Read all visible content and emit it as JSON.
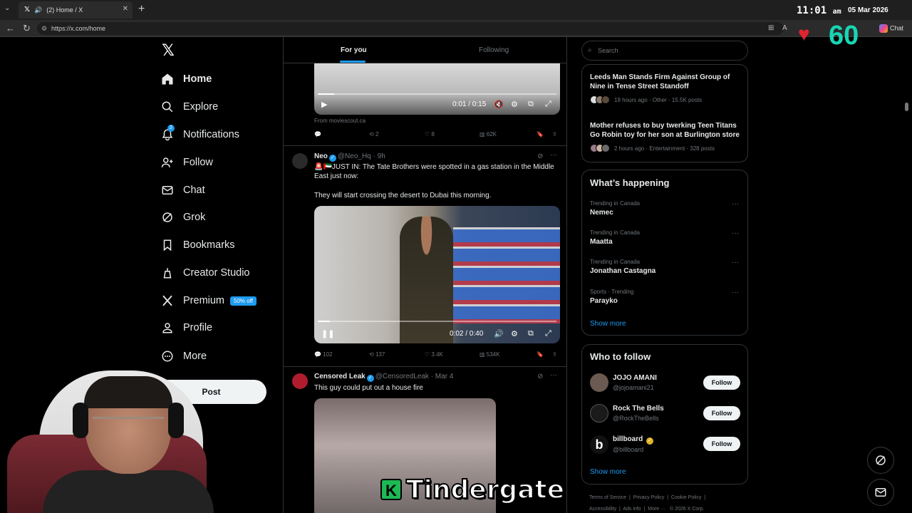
{
  "browser": {
    "tab_title": "(2) Home / X",
    "url": "https://x.com/home",
    "clock": "11:01",
    "clock_suffix": "am",
    "date": "05 Mar 2026",
    "chat_label": "Chat",
    "stream_counter": "60"
  },
  "nav": {
    "items": [
      {
        "label": "Home",
        "icon": "home-icon"
      },
      {
        "label": "Explore",
        "icon": "search-icon"
      },
      {
        "label": "Notifications",
        "icon": "bell-icon",
        "badge": "2"
      },
      {
        "label": "Follow",
        "icon": "add-user-icon"
      },
      {
        "label": "Chat",
        "icon": "mail-icon"
      },
      {
        "label": "Grok",
        "icon": "grok-icon"
      },
      {
        "label": "Bookmarks",
        "icon": "bookmark-icon"
      },
      {
        "label": "Creator Studio",
        "icon": "creator-icon"
      },
      {
        "label": "Premium",
        "icon": "x-icon",
        "badge": "50% off"
      },
      {
        "label": "Profile",
        "icon": "person-icon"
      },
      {
        "label": "More",
        "icon": "more-circle-icon"
      }
    ],
    "post_label": "Post"
  },
  "timeline": {
    "tabs": [
      "For you",
      "Following"
    ],
    "post1": {
      "video_time": "0:01 / 0:15",
      "video_progress": 0.07,
      "source": "From moviescout.ca",
      "reposts": "2",
      "likes": "8",
      "views": "62K"
    },
    "post2": {
      "name": "Neo",
      "handle": "@Neo_Hq",
      "age": "· 9h",
      "text1": "🚨🇦🇪JUST IN: The Tate Brothers were spotted in a gas station in the Middle East just now:",
      "text2": "They will start crossing the desert to Dubai this morning.",
      "video_time": "0:02 / 0:40",
      "video_progress": 0.05,
      "replies": "102",
      "reposts": "137",
      "likes": "3.4K",
      "views": "534K"
    },
    "post3": {
      "name": "Censored Leak",
      "handle": "@CensoredLeak",
      "age": "· Mar 4",
      "text": "This guy could put out a house fire"
    }
  },
  "right": {
    "search_placeholder": "Search",
    "news": [
      {
        "title": "Leeds Man Stands Firm Against Group of Nine in Tense Street Standoff",
        "meta": "19 hours ago · Other · 15.5K posts"
      },
      {
        "title": "Mother refuses to buy twerking Teen Titans Go Robin toy for her son at Burlington store",
        "meta": "2 hours ago · Entertainment · 328 posts"
      }
    ],
    "happening_title": "What’s happening",
    "trends": [
      {
        "meta": "Trending in Canada",
        "name": "Nemec"
      },
      {
        "meta": "Trending in Canada",
        "name": "Maatta"
      },
      {
        "meta": "Trending in Canada",
        "name": "Jonathan Castagna"
      },
      {
        "meta": "Sports · Trending",
        "name": "Parayko"
      }
    ],
    "show_more": "Show more",
    "wtf_title": "Who to follow",
    "wtf": [
      {
        "name": "JOJO AMANI",
        "handle": "@jojoamani21",
        "button": "Follow",
        "color": "#6b5a52"
      },
      {
        "name": "Rock The Bells",
        "handle": "@RockTheBells",
        "button": "Follow",
        "color": "#1a1a1a"
      },
      {
        "name": "billboard",
        "handle": "@billboard",
        "button": "Follow",
        "color": "#111111"
      }
    ],
    "footer_line1": [
      "Terms of Service",
      "Privacy Policy",
      "Cookie Policy"
    ],
    "footer_line2": [
      "Accessibility",
      "Ads info",
      "More ···",
      "© 2026 X Corp."
    ]
  },
  "overlay": {
    "caption": "Tindergate",
    "caption_badge": "K"
  },
  "colors": {
    "accent": "#1d9bf0",
    "border": "#2f3336",
    "muted": "#71767b",
    "counter": "#17d6b4",
    "heart": "#e0252f"
  }
}
